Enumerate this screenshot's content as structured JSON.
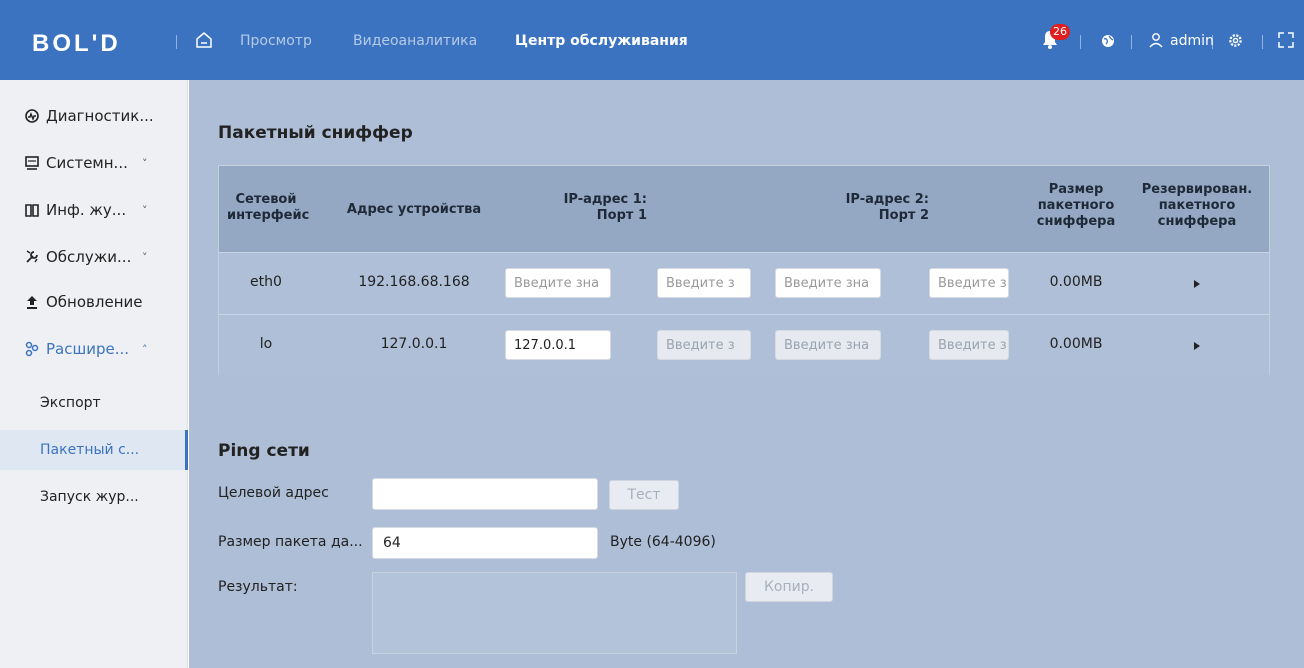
{
  "header": {
    "logo_text": "BOL'D",
    "nav": [
      "Просмотр",
      "Видеоаналитика",
      "Центр обслуживания"
    ],
    "active_nav_index": 2,
    "notification_count": "26",
    "user": "admin",
    "accent_color": "#3b73c0"
  },
  "sidebar": {
    "items": [
      {
        "label": "Диагностик...",
        "icon": "diagnostics-icon"
      },
      {
        "label": "Системн...",
        "icon": "monitor-icon",
        "chevron": "˅"
      },
      {
        "label": "Инф. жу...",
        "icon": "book-icon",
        "chevron": "˅"
      },
      {
        "label": "Обслужи...",
        "icon": "wrench-icon",
        "chevron": "˅"
      },
      {
        "label": "Обновление",
        "icon": "upgrade-icon"
      },
      {
        "label": "Расшире...",
        "icon": "extension-icon",
        "chevron": "˄"
      }
    ],
    "sub_items": [
      {
        "label": "Экспорт"
      },
      {
        "label": "Пакетный с..."
      },
      {
        "label": "Запуск жур..."
      }
    ],
    "active_sub_index": 1
  },
  "sniffer": {
    "title": "Пакетный сниффер",
    "headers": {
      "interface": [
        "Сетевой",
        "интерфейс"
      ],
      "device_address": "Адрес устройства",
      "ip1": [
        "IP-адрес 1:",
        "Порт 1"
      ],
      "ip2": [
        "IP-адрес 2:",
        "Порт 2"
      ],
      "size": [
        "Размер",
        "пакетного",
        "сниффера"
      ],
      "backup": [
        "Резервирован.",
        "пакетного",
        "сниффера"
      ]
    },
    "rows": [
      {
        "interface": "eth0",
        "address": "192.168.68.168",
        "ip1": "Введите зна",
        "port1": "Введите з",
        "ip2": "Введите зна",
        "port2": "Введите з",
        "size": "0.00MB"
      },
      {
        "interface": "lo",
        "address": "127.0.0.1",
        "ip1": "127.0.0.1",
        "port1": "Введите з",
        "ip2": "Введите зна",
        "port2": "Введите з",
        "size": "0.00MB"
      }
    ]
  },
  "ping": {
    "title": "Ping сети",
    "target_label": "Целевой адрес",
    "target_value": "",
    "test_button": "Тест",
    "packet_size_label": "Размер пакета да...",
    "packet_size_value": "64",
    "packet_size_hint": "Byte (64-4096)",
    "result_label": "Результат:",
    "copy_button": "Копир."
  }
}
